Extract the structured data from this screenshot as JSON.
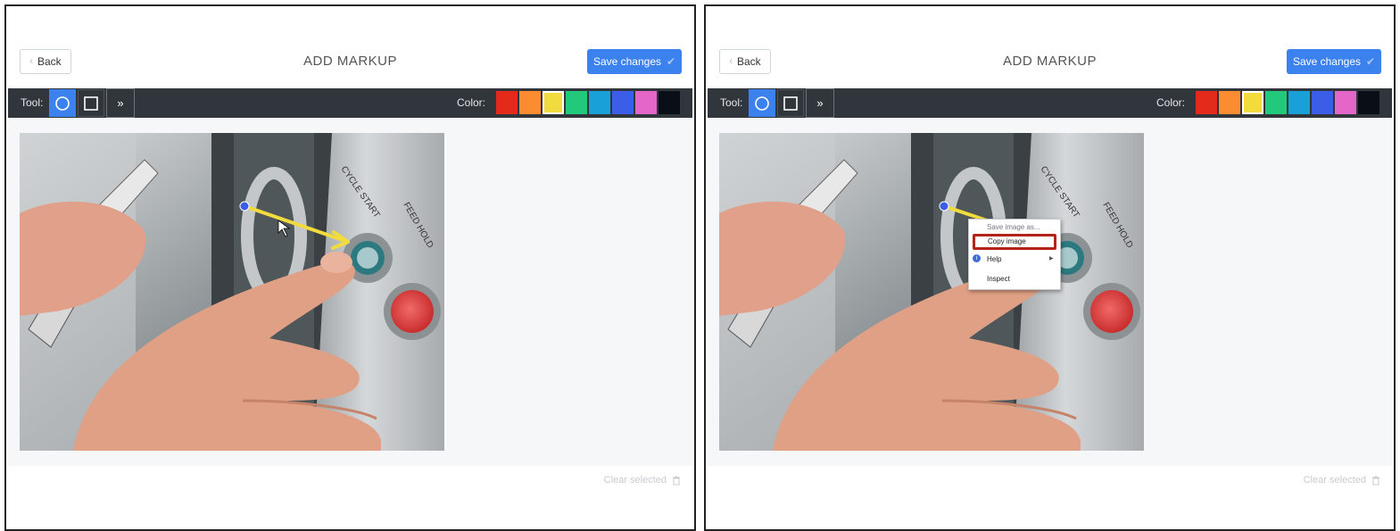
{
  "panels": [
    {
      "back_label": "Back",
      "title": "ADD MARKUP",
      "save_label": "Save changes",
      "tool_label": "Tool:",
      "color_label": "Color:",
      "clear_label": "Clear selected"
    },
    {
      "back_label": "Back",
      "title": "ADD MARKUP",
      "save_label": "Save changes",
      "tool_label": "Tool:",
      "color_label": "Color:",
      "clear_label": "Clear selected",
      "context_menu": {
        "save_image_as": "Save image as...",
        "copy_image": "Copy image",
        "help": "Help",
        "inspect": "Inspect"
      }
    }
  ],
  "swatch_colors": [
    "#e32a1b",
    "#fb8c2f",
    "#f2dc3d",
    "#22c97b",
    "#1aa0d8",
    "#3b5de8",
    "#e466c9",
    "#0a0e16"
  ],
  "selected_color": "#f2dc3d",
  "accent_color": "#3b82ef",
  "icons": {
    "tool_circle": "circle-tool-icon",
    "tool_rect": "rectangle-tool-icon",
    "more": "chevron-double-right-icon",
    "trash": "trash-icon",
    "check": "check-icon",
    "back": "chevron-left-icon"
  }
}
